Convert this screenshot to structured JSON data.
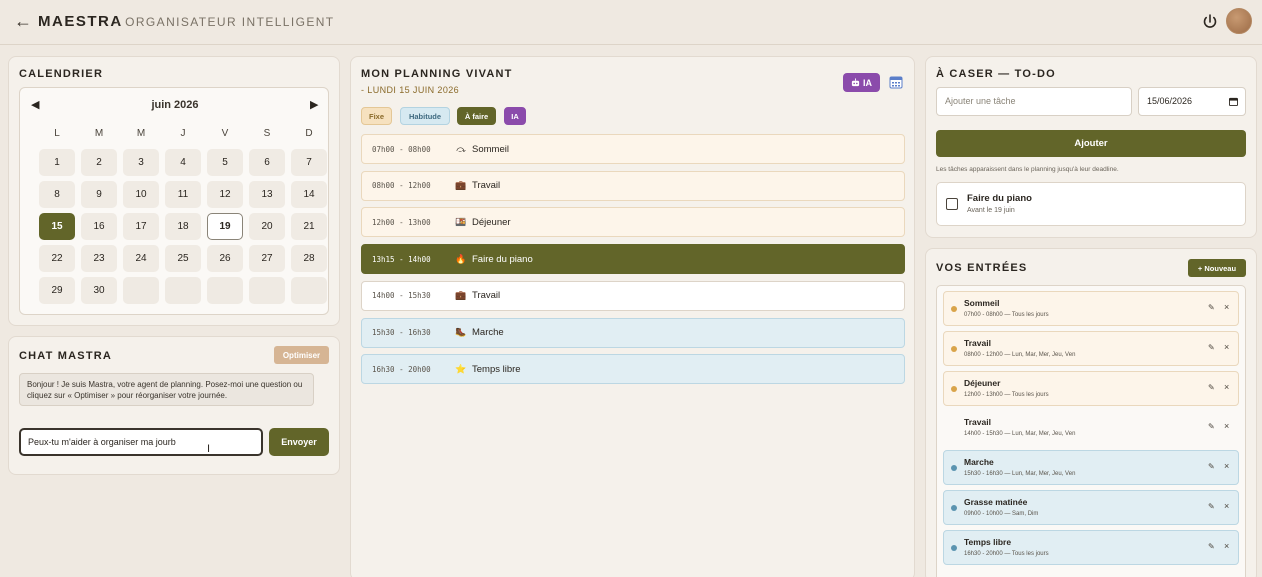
{
  "header": {
    "back_icon": "←",
    "brand": "MAESTRA",
    "tagline": "- ORGANISATEUR INTELLIGENT"
  },
  "calendar": {
    "title": "CALENDRIER",
    "prev": "◀",
    "next": "▶",
    "month": "juin 2026",
    "weekdays": [
      "L",
      "M",
      "M",
      "J",
      "V",
      "S",
      "D"
    ],
    "weeks": [
      [
        "1",
        "2",
        "3",
        "4",
        "5",
        "6",
        "7"
      ],
      [
        "8",
        "9",
        "10",
        "11",
        "12",
        "13",
        "14"
      ],
      [
        "15",
        "16",
        "17",
        "18",
        "19",
        "20",
        "21"
      ],
      [
        "22",
        "23",
        "24",
        "25",
        "26",
        "27",
        "28"
      ],
      [
        "29",
        "30",
        "",
        "",
        "",
        "",
        ""
      ]
    ],
    "selected_day": "15",
    "today_day": "19"
  },
  "chat": {
    "title": "CHAT MASTRA",
    "optimize_label": "Optimiser",
    "message": "Bonjour ! Je suis Mastra, votre agent de planning. Posez-moi une question ou cliquez sur « Optimiser » pour réorganiser votre journée.",
    "input_value": "Peux-tu m'aider à organiser ma jourb",
    "send_label": "Envoyer"
  },
  "planning": {
    "title": "MON PLANNING VIVANT",
    "date": "- LUNDI 15 JUIN 2026",
    "ia_button": "IA",
    "legend": [
      {
        "label": "Fixe",
        "bg": "#f6e1bf",
        "color": "#8a6a2a",
        "border": "#e4c796"
      },
      {
        "label": "Habitude",
        "bg": "#d6e9f1",
        "color": "#3f6a80",
        "border": "#b3d3e1"
      },
      {
        "label": "À faire",
        "bg": "#626529",
        "color": "#ffffff",
        "border": "#626529"
      },
      {
        "label": "IA",
        "bg": "#8b4bab",
        "color": "#ffffff",
        "border": "#8b4bab"
      }
    ],
    "slots": [
      {
        "time": "07h00 - 08h00",
        "icon": "⤼",
        "label": "Sommeil",
        "kind": "fixe"
      },
      {
        "time": "08h00 - 12h00",
        "icon": "💼",
        "label": "Travail",
        "kind": "fixe"
      },
      {
        "time": "12h00 - 13h00",
        "icon": "🍱",
        "label": "Déjeuner",
        "kind": "fixe"
      },
      {
        "time": "13h15 - 14h00",
        "icon": "🔥",
        "label": "Faire du piano",
        "kind": "active"
      },
      {
        "time": "14h00 - 15h30",
        "icon": "💼",
        "label": "Travail",
        "kind": "white"
      },
      {
        "time": "15h30 - 16h30",
        "icon": "🥾",
        "label": "Marche",
        "kind": "habit"
      },
      {
        "time": "16h30 - 20h00",
        "icon": "⭐",
        "label": "Temps libre",
        "kind": "habit"
      }
    ]
  },
  "todo": {
    "title": "À CASER — TO-DO",
    "input_placeholder": "Ajouter une tâche",
    "date_value": "15/06/2026",
    "add_label": "Ajouter",
    "hint": "Les tâches apparaissent dans le planning jusqu'à leur deadline.",
    "items": [
      {
        "title": "Faire du piano",
        "sub": "Avant le 19 juin"
      }
    ]
  },
  "entries": {
    "title": "VOS ENTRÉES",
    "new_label": "+ Nouveau",
    "edit_icon": "✎",
    "delete_icon": "×",
    "items": [
      {
        "title": "Sommeil",
        "sub": "07h00 - 08h00 — Tous les jours",
        "kind": "fixe",
        "dot": "#d9a44a"
      },
      {
        "title": "Travail",
        "sub": "08h00 - 12h00 — Lun, Mar, Mer, Jeu, Ven",
        "kind": "fixe",
        "dot": "#d9a44a"
      },
      {
        "title": "Déjeuner",
        "sub": "12h00 - 13h00 — Tous les jours",
        "kind": "fixe",
        "dot": "#d9a44a"
      },
      {
        "title": "Travail",
        "sub": "14h00 - 15h30 — Lun, Mar, Mer, Jeu, Ven",
        "kind": "plain",
        "dot": ""
      },
      {
        "title": "Marche",
        "sub": "15h30 - 16h30 — Lun, Mar, Mer, Jeu, Ven",
        "kind": "habit",
        "dot": "#5b94b0"
      },
      {
        "title": "Grasse matinée",
        "sub": "09h00 - 10h00 — Sam, Dim",
        "kind": "habit",
        "dot": "#5b94b0"
      },
      {
        "title": "Temps libre",
        "sub": "16h30 - 20h00 — Tous les jours",
        "kind": "habit",
        "dot": "#5b94b0"
      }
    ]
  }
}
